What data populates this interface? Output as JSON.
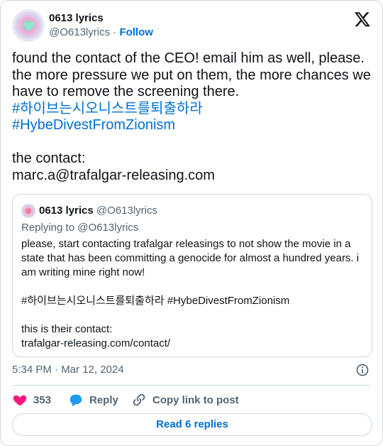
{
  "author": {
    "display_name": "0613 lyrics",
    "handle": "@O613lyrics",
    "separator": "·",
    "follow_label": "Follow"
  },
  "tweet": {
    "line1": "found the contact of the CEO! email him as well, please.",
    "line2": "the more pressure we put on them, the more chances we have to remove the screening there.",
    "hashtag1": "#하이브는시오니스트를퇴출하라",
    "hashtag2": "#HybeDivestFromZionism",
    "contact_label": "the contact:",
    "contact_email": "marc.a@trafalgar-releasing.com"
  },
  "quote": {
    "display_name": "0613 lyrics",
    "handle": "@O613lyrics",
    "replying_to": "Replying to @O613lyrics",
    "text": "please, start contacting trafalgar releasings to not show the movie in a state that has been committing a genocide for almost a hundred years. i am writing mine right now!\n\n#하이브는시오니스트를퇴출하라  #HybeDivestFromZionism\n\nthis is their contact:\ntrafalgar-releasing.com/contact/"
  },
  "meta": {
    "timestamp": "5:34 PM · Mar 12, 2024"
  },
  "actions": {
    "like_count": "353",
    "reply_label": "Reply",
    "copy_label": "Copy link to post"
  },
  "footer": {
    "read_replies_label": "Read 6 replies"
  },
  "colors": {
    "link": "#006fd6",
    "like": "#f91880",
    "reply_icon": "#1d9bf0",
    "muted": "#536471"
  },
  "icons": [
    "x-logo-icon",
    "heart-icon",
    "reply-bubble-icon",
    "link-icon",
    "info-icon"
  ]
}
